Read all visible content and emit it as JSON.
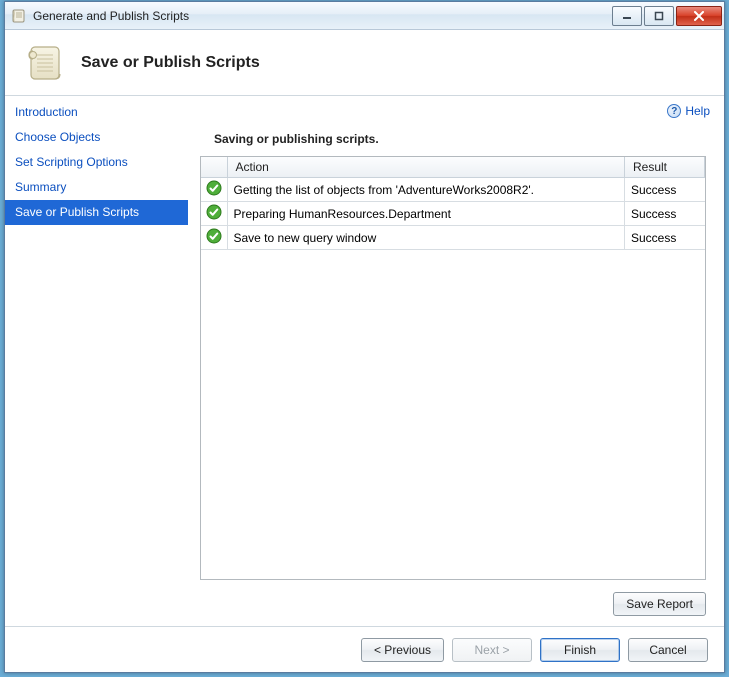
{
  "window": {
    "title": "Generate and Publish Scripts"
  },
  "header": {
    "title": "Save or Publish Scripts"
  },
  "help": {
    "label": "Help"
  },
  "sidebar": {
    "items": [
      {
        "label": "Introduction",
        "selected": false
      },
      {
        "label": "Choose Objects",
        "selected": false
      },
      {
        "label": "Set Scripting Options",
        "selected": false
      },
      {
        "label": "Summary",
        "selected": false
      },
      {
        "label": "Save or Publish Scripts",
        "selected": true
      }
    ]
  },
  "main": {
    "section_title": "Saving or publishing scripts.",
    "columns": {
      "action": "Action",
      "result": "Result"
    },
    "rows": [
      {
        "action": "Getting the list of objects from 'AdventureWorks2008R2'.",
        "result": "Success"
      },
      {
        "action": "Preparing HumanResources.Department",
        "result": "Success"
      },
      {
        "action": "Save to new query window",
        "result": "Success"
      }
    ],
    "save_report_label": "Save Report"
  },
  "footer": {
    "previous": "< Previous",
    "next": "Next >",
    "finish": "Finish",
    "cancel": "Cancel"
  }
}
